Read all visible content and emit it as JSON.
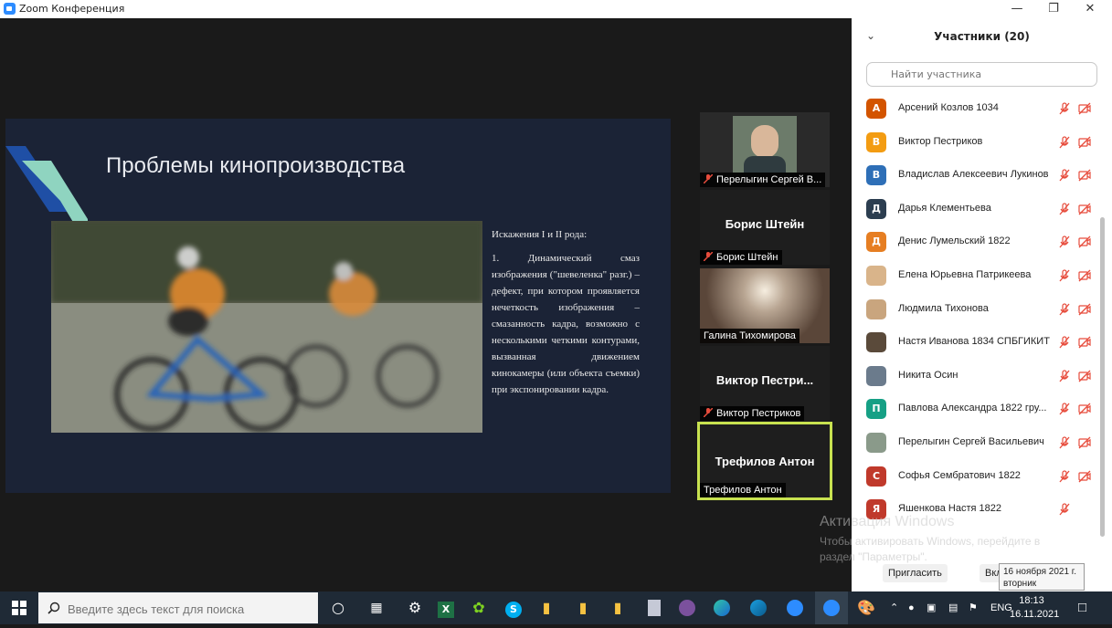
{
  "window": {
    "title": "Zoom Конференция"
  },
  "slide": {
    "title": "Проблемы кинопроизводства",
    "heading": "Искажения I и II рода:",
    "paragraph": "1. Динамический смаз изображения (\"шевеленка\" разг.) – дефект, при котором проявляется нечеткость изображения – смазанность кадра, возможно с несколькими четкими контурами, вызванная движением кинокамеры (или объекта съемки) при экспонировании кадра."
  },
  "tiles": [
    {
      "label": "Перелыгин Сергей В..."
    },
    {
      "big": "Борис Штейн",
      "label": "Борис Штейн"
    },
    {
      "label": "Галина Тихомирова"
    },
    {
      "big": "Виктор  Пестри...",
      "label": "Виктор Пестриков"
    },
    {
      "big": "Трефилов Антон",
      "label": "Трефилов Антон"
    }
  ],
  "panel": {
    "title": "Участники (20)",
    "search_placeholder": "Найти участника",
    "participants": [
      {
        "initial": "А",
        "name": "Арсений Козлов 1034",
        "color": "#d35400"
      },
      {
        "initial": "В",
        "name": "Виктор Пестриков",
        "color": "#f39c12"
      },
      {
        "initial": "В",
        "name": "Владислав Алексеевич Лукинов",
        "color": "#2e6fb7"
      },
      {
        "initial": "Д",
        "name": "Дарья Клементьева",
        "color": "#2c3e50"
      },
      {
        "initial": "Д",
        "name": "Денис Лумельский 1822",
        "color": "#e67e22"
      },
      {
        "initial": "",
        "name": "Елена Юрьевна Патрикеева",
        "color": "#d9b48a"
      },
      {
        "initial": "",
        "name": "Людмила Тихонова",
        "color": "#c9a57e"
      },
      {
        "initial": "",
        "name": "Настя Иванова 1834 СПБГИКИТ",
        "color": "#5a4a3a"
      },
      {
        "initial": "",
        "name": "Никита Осин",
        "color": "#6b7b8c"
      },
      {
        "initial": "П",
        "name": "Павлова Александра 1822 гру...",
        "color": "#16a085"
      },
      {
        "initial": "",
        "name": "Перелыгин Сергей Васильевич",
        "color": "#8a9a8a"
      },
      {
        "initial": "С",
        "name": "Софья Сембратович 1822",
        "color": "#c0392b"
      },
      {
        "initial": "Я",
        "name": "Яшенкова Настя 1822",
        "color": "#c0392b"
      }
    ],
    "invite": "Пригласить",
    "mute_all": "Вкл"
  },
  "activation": {
    "line1": "Активация Windows",
    "line2": "Чтобы активировать Windows, перейдите в",
    "line3": "раздел \"Параметры\"."
  },
  "tooltip": {
    "line1": "16 ноября 2021 г.",
    "line2": "вторник"
  },
  "taskbar": {
    "search_placeholder": "Введите здесь текст для поиска",
    "lang": "ENG",
    "time": "18:13",
    "date": "16.11.2021"
  }
}
